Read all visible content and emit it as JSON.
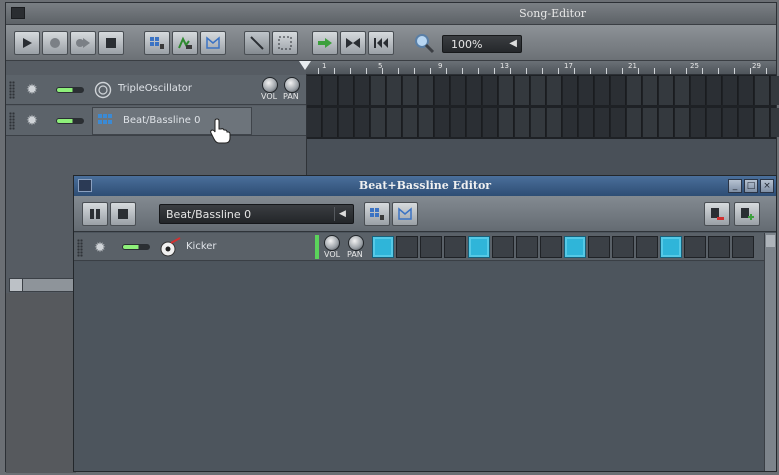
{
  "song_editor": {
    "title": "Song-Editor",
    "zoom": "100%",
    "timeline_numbers": [
      "1",
      "5",
      "9",
      "13",
      "17",
      "21",
      "25",
      "29"
    ],
    "tracks": [
      {
        "name": "TripleOscillator",
        "knob_labels": [
          "VOL",
          "PAN"
        ]
      },
      {
        "name": "Beat/Bassline 0"
      }
    ]
  },
  "bb_editor": {
    "title": "Beat+Bassline Editor",
    "selected_pattern": "Beat/Bassline 0",
    "window_buttons": [
      "_",
      "□",
      "×"
    ],
    "tracks": [
      {
        "name": "Kicker",
        "knob_labels": [
          "VOL",
          "PAN"
        ],
        "steps": [
          1,
          0,
          0,
          0,
          1,
          0,
          0,
          0,
          1,
          0,
          0,
          0,
          1,
          0,
          0,
          0
        ]
      }
    ]
  },
  "colors": {
    "step_on": "#2fb5d9",
    "titlebar_active": "#3b5d88",
    "led_green": "#8ef07a"
  }
}
